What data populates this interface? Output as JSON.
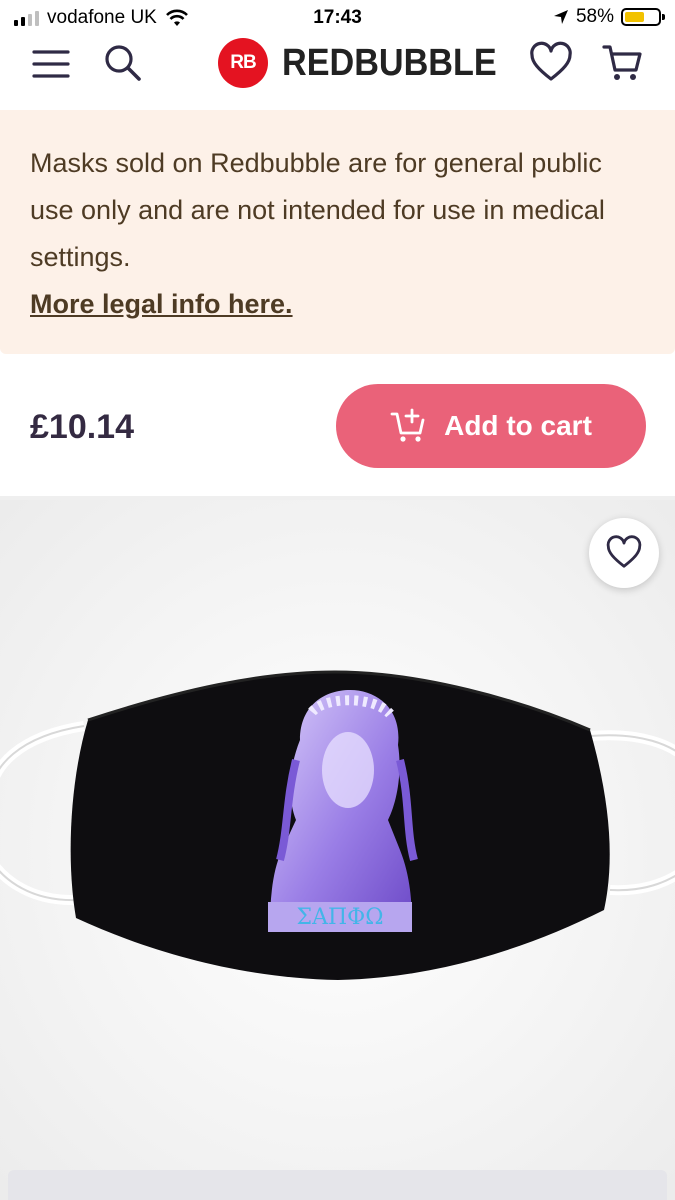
{
  "status": {
    "carrier": "vodafone UK",
    "time": "17:43",
    "battery_percent": "58%",
    "battery_level": 0.58,
    "battery_color": "#f2c200"
  },
  "header": {
    "menu_icon": "hamburger-menu-icon",
    "search_icon": "search-icon",
    "logo_mark": "RB",
    "logo_text": "REDBUBBLE",
    "wishlist_icon": "heart-icon",
    "cart_icon": "cart-icon",
    "brand_color": "#e41321"
  },
  "notice": {
    "text": "Masks sold on Redbubble are for general public use only and are not intended for use in medical settings.",
    "link": "More legal info here.",
    "background": "#fdf1e8"
  },
  "purchase": {
    "price": "£10.14",
    "add_to_cart": "Add to cart",
    "button_color": "#ea6279"
  },
  "product": {
    "mask_inscription": "ΣΑΠΦΩ",
    "favorite_icon": "heart-icon"
  }
}
